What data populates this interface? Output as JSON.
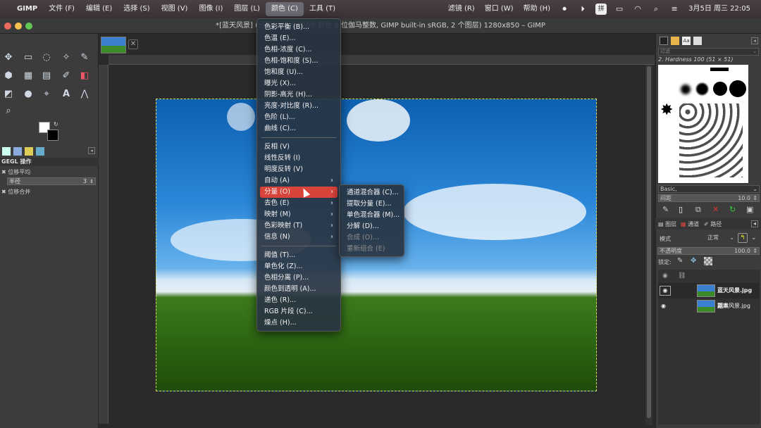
{
  "macbar": {
    "items": [
      "GIMP",
      "文件 (F)",
      "编辑 (E)",
      "选择 (S)",
      "视图 (V)",
      "图像 (I)",
      "图层 (L)",
      "颜色 (C)",
      "工具 (T)"
    ],
    "right_items": [
      "滤镜 (R)",
      "窗口 (W)",
      "帮助 (H)"
    ],
    "input_method": "拼",
    "datetime": "3月5日 周三  22:05"
  },
  "window": {
    "title": "*[蓝天风景] (已导入)-3.0 (RGB 颜色 8 位伽马整数, GIMP built-in sRGB, 2 个图层) 1280x850 – GIMP"
  },
  "toolbox": {
    "gegl_title": "GEGL 操作",
    "gegl_item1": "位移平均",
    "radius_label": "半径",
    "radius_value": "3",
    "gegl_item2": "位移合并"
  },
  "dock": {
    "filter_placeholder": "过滤",
    "brush_name": "2. Hardness 100 (51 × 51)",
    "brush_preset": "Basic,",
    "spacing_label": "间距",
    "spacing_value": "10.0",
    "tabs": [
      "图层",
      "通道",
      "路径"
    ],
    "mode_label": "模式",
    "mode_value": "正常",
    "opacity_label": "不透明度",
    "opacity_value": "100.0",
    "lock_label": "锁定:",
    "layers": [
      "蓝天风景.jpg 副本",
      "蓝天风景.jpg"
    ]
  },
  "colors_menu": {
    "items": [
      {
        "label": "色彩平衡 (B)..."
      },
      {
        "label": "色温 (E)..."
      },
      {
        "label": "色相-浓度 (C)..."
      },
      {
        "label": "色相-饱和度 (S)..."
      },
      {
        "label": "饱和度 (U)..."
      },
      {
        "label": "曝光 (X)..."
      },
      {
        "label": "阴影-高光 (H)..."
      },
      {
        "label": "亮度-对比度 (R)..."
      },
      {
        "label": "色阶 (L)..."
      },
      {
        "label": "曲线 (C)..."
      },
      {
        "label": "反相 (V)"
      },
      {
        "label": "线性反转 (I)"
      },
      {
        "label": "明度反转 (V)"
      },
      {
        "label": "自动 (A)"
      },
      {
        "label": "分量 (O)"
      },
      {
        "label": "去色 (E)"
      },
      {
        "label": "映射 (M)"
      },
      {
        "label": "色彩映射 (T)"
      },
      {
        "label": "信息 (N)"
      },
      {
        "label": "阈值 (T)..."
      },
      {
        "label": "单色化 (Z)..."
      },
      {
        "label": "色相分离 (P)..."
      },
      {
        "label": "颜色到透明 (A)..."
      },
      {
        "label": "递色 (R)..."
      },
      {
        "label": "RGB 片段 (C)..."
      },
      {
        "label": "燥点 (H)..."
      }
    ]
  },
  "components_menu": {
    "items": [
      {
        "label": "通道混合器 (C)..."
      },
      {
        "label": "提取分量 (E)..."
      },
      {
        "label": "单色混合器 (M)..."
      },
      {
        "label": "分解 (D)..."
      },
      {
        "label": "合成 (O)..."
      },
      {
        "label": "重新组合 (E)"
      }
    ]
  }
}
